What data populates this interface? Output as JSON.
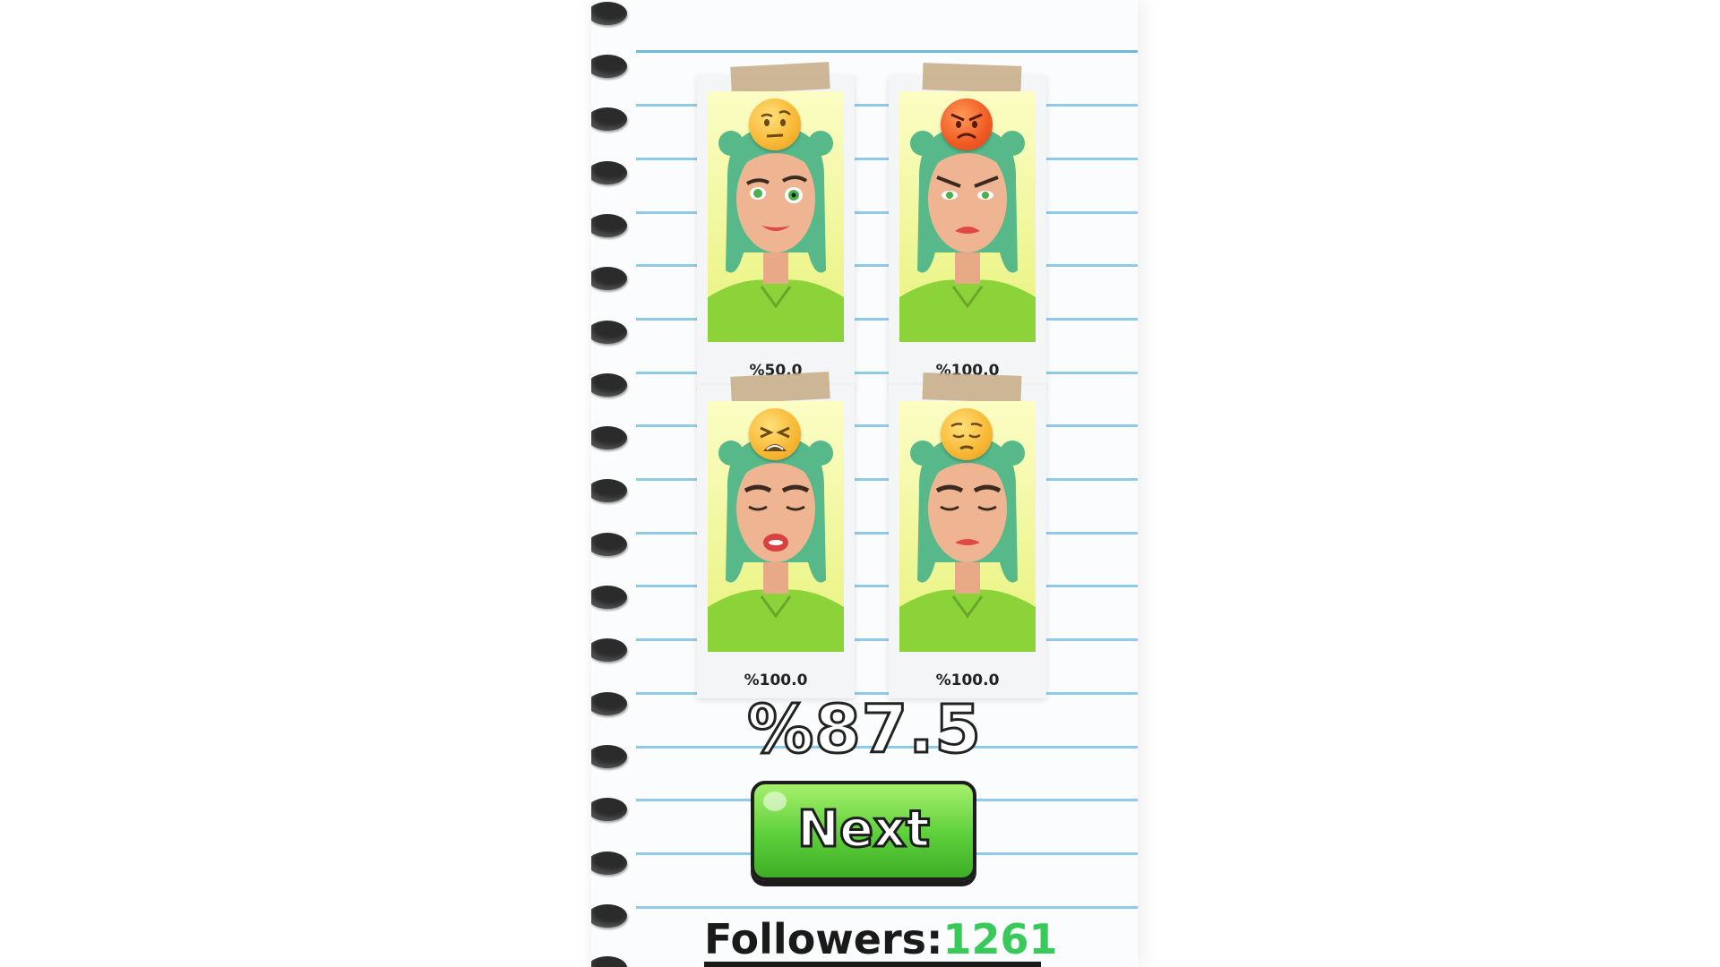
{
  "cards": [
    {
      "emoji": "raised-eyebrow-emoji",
      "score": "%50.0",
      "eyes": "open"
    },
    {
      "emoji": "angry-face-emoji",
      "score": "%100.0",
      "eyes": "open"
    },
    {
      "emoji": "weary-face-emoji",
      "score": "%100.0",
      "eyes": "closed"
    },
    {
      "emoji": "pensive-face-emoji",
      "score": "%100.0",
      "eyes": "closed"
    }
  ],
  "total_score": "%87.5",
  "next_button": {
    "label": "Next"
  },
  "followers": {
    "label": "Followers:",
    "value": "1261"
  },
  "colors": {
    "button_green": "#5ccf3a",
    "followers_value": "#38c95a",
    "hair": "#57b98a",
    "shirt": "#8cd33a",
    "rule_line": "#8fcbe6"
  }
}
